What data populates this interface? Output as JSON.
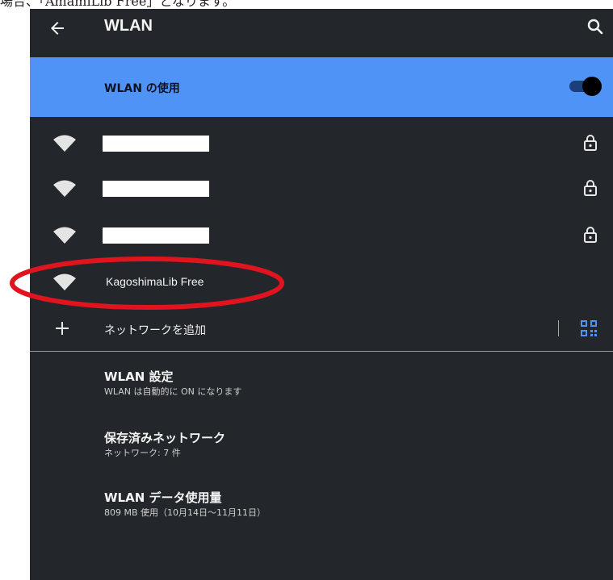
{
  "page_caption": "場合、「AmamiLib Free」となります。",
  "topbar": {
    "title": "WLAN"
  },
  "wlan_toggle": {
    "label": "WLAN の使用",
    "state": "on"
  },
  "networks": [
    {
      "ssid": "",
      "redacted": true,
      "locked": true
    },
    {
      "ssid": "",
      "redacted": true,
      "locked": true
    },
    {
      "ssid": "",
      "redacted": true,
      "locked": true
    },
    {
      "ssid": "KagoshimaLib Free",
      "redacted": false,
      "locked": false
    }
  ],
  "add_network": {
    "label": "ネットワークを追加"
  },
  "settings": [
    {
      "title": "WLAN 設定",
      "subtitle": "WLAN は自動的に ON になります"
    },
    {
      "title": "保存済みネットワーク",
      "subtitle": "ネットワーク: 7 件"
    },
    {
      "title": "WLAN データ使用量",
      "subtitle": "809 MB 使用（10月14日～11月11日）"
    }
  ],
  "colors": {
    "screen_bg": "#23272b",
    "toggle_row_bg": "#4f93f6",
    "qr_icon": "#4f93f6",
    "annotation": "#e0141e"
  },
  "icons": [
    "back-arrow-icon",
    "search-icon",
    "wifi-icon",
    "lock-icon",
    "plus-icon",
    "qr-code-icon"
  ]
}
